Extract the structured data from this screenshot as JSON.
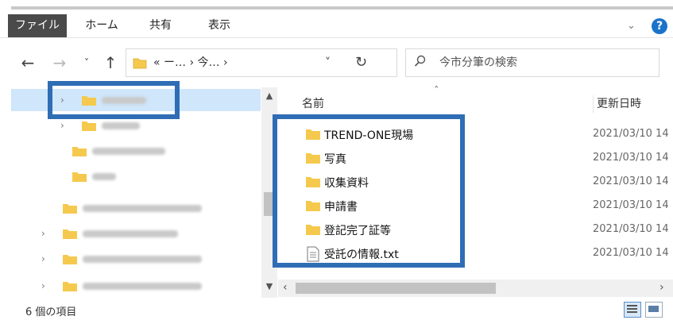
{
  "ribbon": {
    "tabs": [
      "ファイル",
      "ホーム",
      "共有",
      "表示"
    ],
    "help_icon": "?"
  },
  "nav": {
    "back_icon": "←",
    "forward_icon": "→",
    "recent_icon": "˅",
    "up_icon": "↑"
  },
  "address": {
    "crumbs": "«  ー…  ›  今…  ›",
    "dropdown_icon": "˅",
    "refresh_icon": "↻"
  },
  "search": {
    "placeholder": "今市分筆の検索"
  },
  "columns": {
    "name": "名前",
    "date": "更新日時"
  },
  "files": [
    {
      "name": "TREND-ONE現場",
      "date": "2021/03/10 14",
      "type": "folder"
    },
    {
      "name": "写真",
      "date": "2021/03/10 14",
      "type": "folder"
    },
    {
      "name": "収集資料",
      "date": "2021/03/10 14",
      "type": "folder"
    },
    {
      "name": "申請書",
      "date": "2021/03/10 14",
      "type": "folder"
    },
    {
      "name": "登記完了証等",
      "date": "2021/03/10 14",
      "type": "folder"
    },
    {
      "name": "受託の情報.txt",
      "date": "2021/03/10 14",
      "type": "text"
    }
  ],
  "status": {
    "count": "6 個の項目"
  },
  "colors": {
    "highlight": "#2f6db5",
    "selection": "#cfe6fb",
    "folder": "#f5c94d",
    "file_tab": "#4a4a4a"
  }
}
